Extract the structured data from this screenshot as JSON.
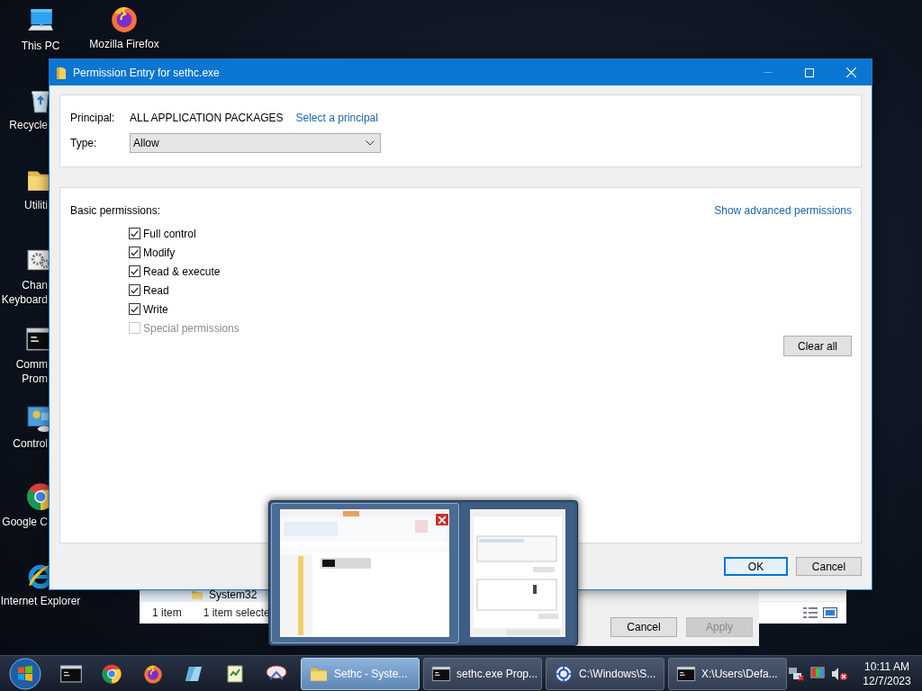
{
  "desktop": {
    "icons": [
      {
        "kind": "pc",
        "lines": [
          "This PC"
        ]
      },
      {
        "kind": "firefox",
        "lines": [
          "Mozilla Firefox"
        ]
      },
      {
        "kind": "recycle",
        "lines": [
          "Recycle"
        ]
      },
      {
        "kind": "folder",
        "lines": [
          "Utiliti"
        ]
      },
      {
        "kind": "settings",
        "lines": [
          "Chan",
          "Keyboard"
        ]
      },
      {
        "kind": "terminal",
        "lines": [
          "Comm",
          "Prom"
        ]
      },
      {
        "kind": "control",
        "lines": [
          "Control"
        ]
      },
      {
        "kind": "chrome",
        "lines": [
          "Google C"
        ]
      },
      {
        "kind": "ie",
        "lines": [
          "Internet Explorer"
        ]
      }
    ]
  },
  "explorer_window": {
    "item": "System32",
    "status_items": [
      "1 item",
      "1 item selecte"
    ]
  },
  "properties_window": {
    "buttons": [
      {
        "label": "Cancel",
        "disabled": false
      },
      {
        "label": "Apply",
        "disabled": true
      }
    ]
  },
  "dialog": {
    "title": "Permission Entry for sethc.exe",
    "principal_label": "Principal:",
    "principal": "ALL APPLICATION PACKAGES",
    "select_principal_link": "Select a principal",
    "type_label": "Type:",
    "type": "Allow",
    "basic_permissions_label": "Basic permissions:",
    "advanced_link": "Show advanced permissions",
    "permissions": [
      {
        "label": "Full control",
        "checked": true,
        "disabled": false
      },
      {
        "label": "Modify",
        "checked": true,
        "disabled": false
      },
      {
        "label": "Read & execute",
        "checked": true,
        "disabled": false
      },
      {
        "label": "Read",
        "checked": true,
        "disabled": false
      },
      {
        "label": "Write",
        "checked": true,
        "disabled": false
      },
      {
        "label": "Special permissions",
        "checked": false,
        "disabled": true
      }
    ],
    "clear_all_button": "Clear all",
    "buttons": [
      {
        "label": "OK",
        "selected": true
      },
      {
        "label": "Cancel",
        "selected": false
      }
    ]
  },
  "taskbar_preview": {
    "thumbnails": [
      {
        "kind": "picture",
        "hovered": true
      },
      {
        "kind": "picture",
        "hovered": false
      }
    ]
  },
  "taskbar": {
    "tasks": [
      {
        "kind": "folder",
        "label": "Sethc - Syste...",
        "selected": true
      },
      {
        "kind": "terminal",
        "label": "sethc.exe Prop...",
        "selected": false
      },
      {
        "kind": "globe",
        "label": "C:\\Windows\\S...",
        "selected": false
      },
      {
        "kind": "terminal",
        "label": "X:\\Users\\Defa...",
        "selected": false
      }
    ],
    "clock": {
      "time": "10:11 AM",
      "date": "12/7/2023"
    }
  }
}
